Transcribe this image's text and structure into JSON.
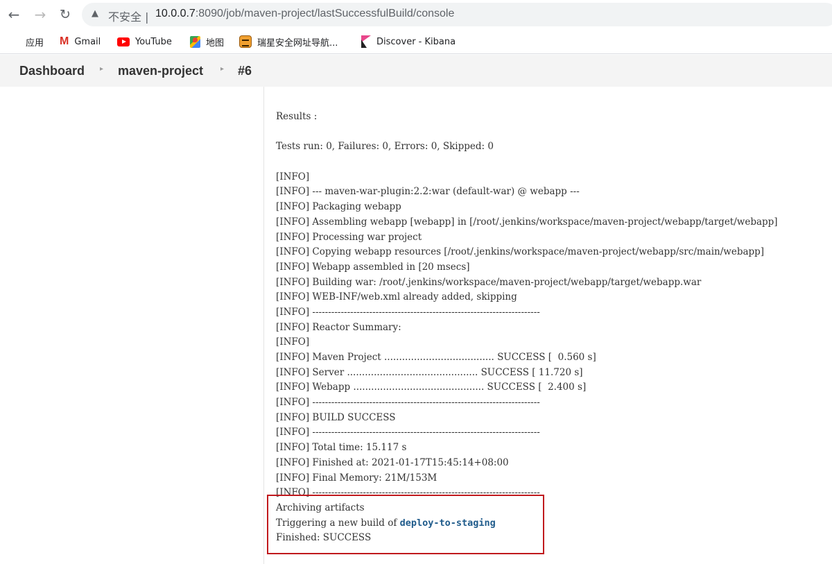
{
  "browser": {
    "back_glyph": "←",
    "forward_glyph": "→",
    "reload_glyph": "↻",
    "security_label": "不安全",
    "security_divider": "|",
    "url_host": "10.0.0.7",
    "url_rest": ":8090/job/maven-project/lastSuccessfulBuild/console"
  },
  "bookmarks": [
    {
      "label": "应用",
      "icon": "apps-grid-icon"
    },
    {
      "label": "Gmail",
      "icon": "gmail-icon"
    },
    {
      "label": "YouTube",
      "icon": "youtube-icon"
    },
    {
      "label": "地图",
      "icon": "maps-icon"
    },
    {
      "label": "瑞星安全网址导航...",
      "icon": "rising-tiger-icon"
    },
    {
      "label": "Discover - Kibana",
      "icon": "kibana-icon"
    }
  ],
  "breadcrumb": [
    {
      "label": "Dashboard"
    },
    {
      "label": "maven-project"
    },
    {
      "label": "#6"
    }
  ],
  "breadcrumb_sep": "▸",
  "console": {
    "lines": [
      "Results :",
      "",
      "Tests run: 0, Failures: 0, Errors: 0, Skipped: 0",
      "",
      "[INFO]",
      "[INFO] --- maven-war-plugin:2.2:war (default-war) @ webapp ---",
      "[INFO] Packaging webapp",
      "[INFO] Assembling webapp [webapp] in [/root/.jenkins/workspace/maven-project/webapp/target/webapp]",
      "[INFO] Processing war project",
      "[INFO] Copying webapp resources [/root/.jenkins/workspace/maven-project/webapp/src/main/webapp]",
      "[INFO] Webapp assembled in [20 msecs]",
      "[INFO] Building war: /root/.jenkins/workspace/maven-project/webapp/target/webapp.war",
      "[INFO] WEB-INF/web.xml already added, skipping",
      "[INFO] ------------------------------------------------------------------------",
      "[INFO] Reactor Summary:",
      "[INFO]",
      "[INFO] Maven Project ..................................... SUCCESS [  0.560 s]",
      "[INFO] Server ............................................ SUCCESS [ 11.720 s]",
      "[INFO] Webapp ............................................ SUCCESS [  2.400 s]",
      "[INFO] ------------------------------------------------------------------------",
      "[INFO] BUILD SUCCESS",
      "[INFO] ------------------------------------------------------------------------",
      "[INFO] Total time: 15.117 s",
      "[INFO] Finished at: 2021-01-17T15:45:14+08:00",
      "[INFO] Final Memory: 21M/153M",
      "[INFO] ------------------------------------------------------------------------",
      "Archiving artifacts"
    ],
    "trigger_prefix": "Triggering a new build of ",
    "trigger_link": "deploy-to-staging",
    "finished_line": "Finished: SUCCESS"
  },
  "colors": {
    "highlight_border": "#c0191d",
    "link": "#1f5b8b",
    "breadcrumb_bg": "#f4f4f4"
  }
}
